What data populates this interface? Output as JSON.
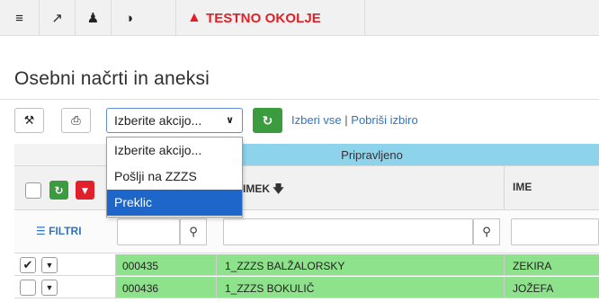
{
  "toolbar": {
    "icons": [
      "list-indent-icon",
      "external-link-icon",
      "spy-user-icon",
      "contrast-icon"
    ],
    "warning_label": "TESTNO OKOLJE",
    "warning_color": "#e21f26"
  },
  "page": {
    "title": "Osebni načrti in aneksi"
  },
  "actions": {
    "select_value": "Izberite akcijo...",
    "select_all": "Izberi vse",
    "separator": "|",
    "clear_selection": "Pobriši izbiro"
  },
  "dropdown": {
    "options": [
      "Izberite akcijo...",
      "Pošlji na ZZZS",
      "Preklic"
    ],
    "highlighted": "Preklic"
  },
  "table": {
    "group_header": "Pripravljeno",
    "columns": [
      "PRIIMEK",
      "IME"
    ],
    "sort_column": "PRIIMEK",
    "filters_label": "FILTRI",
    "rows": [
      {
        "id": "000435",
        "surname": "1_ZZZS BALŽALORSKY",
        "name": "ZEKIRA",
        "checked": true
      },
      {
        "id": "000436",
        "surname": "1_ZZZS BOKULIČ",
        "name": "JOŽEFA",
        "checked": false
      }
    ],
    "row_color": "#8fe28c"
  }
}
